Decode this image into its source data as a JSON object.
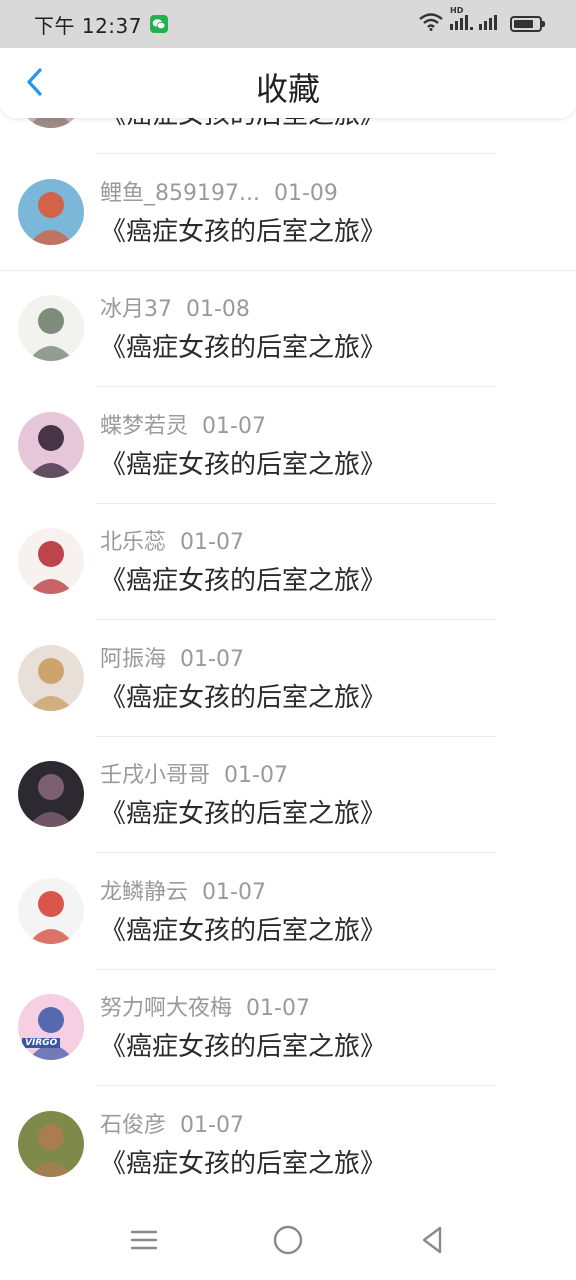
{
  "status_bar": {
    "time": "下午 12:37",
    "hd_label": "HD"
  },
  "header": {
    "title": "收藏"
  },
  "items": [
    {
      "user": "",
      "date": "",
      "title": "《癌症女孩的后室之旅》",
      "avatar_colors": [
        "#c9b8b4",
        "#8a7772"
      ]
    },
    {
      "user": "鲤鱼_859197...",
      "date": "01-09",
      "title": "《癌症女孩的后室之旅》",
      "avatar_colors": [
        "#7bb7d8",
        "#e0552f"
      ]
    },
    {
      "user": "冰月37",
      "date": "01-08",
      "title": "《癌症女孩的后室之旅》",
      "avatar_colors": [
        "#f2f2ee",
        "#6a7a66"
      ]
    },
    {
      "user": "蝶梦若灵",
      "date": "01-07",
      "title": "《癌症女孩的后室之旅》",
      "avatar_colors": [
        "#e6c7da",
        "#2a1b2c"
      ]
    },
    {
      "user": "北乐蕊",
      "date": "01-07",
      "title": "《癌症女孩的后室之旅》",
      "avatar_colors": [
        "#f7f1ef",
        "#b3262e"
      ]
    },
    {
      "user": "阿振海",
      "date": "01-07",
      "title": "《癌症女孩的后室之旅》",
      "avatar_colors": [
        "#e8dfd8",
        "#c99a5c"
      ]
    },
    {
      "user": "壬戌小哥哥",
      "date": "01-07",
      "title": "《癌症女孩的后室之旅》",
      "avatar_colors": [
        "#2c2a30",
        "#8b6a7a"
      ]
    },
    {
      "user": "龙鳞静云",
      "date": "01-07",
      "title": "《癌症女孩的后室之旅》",
      "avatar_colors": [
        "#f4f4f4",
        "#d23b2c"
      ]
    },
    {
      "user": "努力啊大夜梅",
      "date": "01-07",
      "title": "《癌症女孩的后室之旅》",
      "avatar_colors": [
        "#f6cfe2",
        "#3a57a6"
      ],
      "avatar_text": "VIRGO"
    },
    {
      "user": "石俊彦",
      "date": "01-07",
      "title": "《癌症女孩的后室之旅》",
      "avatar_colors": [
        "#7d8a4a",
        "#b07a52"
      ]
    }
  ],
  "colors": {
    "accent": "#2196f3",
    "status_bar_bg": "#d9d9d9",
    "meta_text": "#9a9a9a",
    "title_text": "#2b2b2b"
  },
  "icons": {
    "back": "chevron-left-icon",
    "menu": "menu-icon",
    "home": "home-circle-icon",
    "back_nav": "triangle-back-icon",
    "wifi": "wifi-icon",
    "signal": "signal-icon",
    "battery": "battery-icon",
    "wechat": "wechat-icon"
  },
  "battery_level": 0.8
}
